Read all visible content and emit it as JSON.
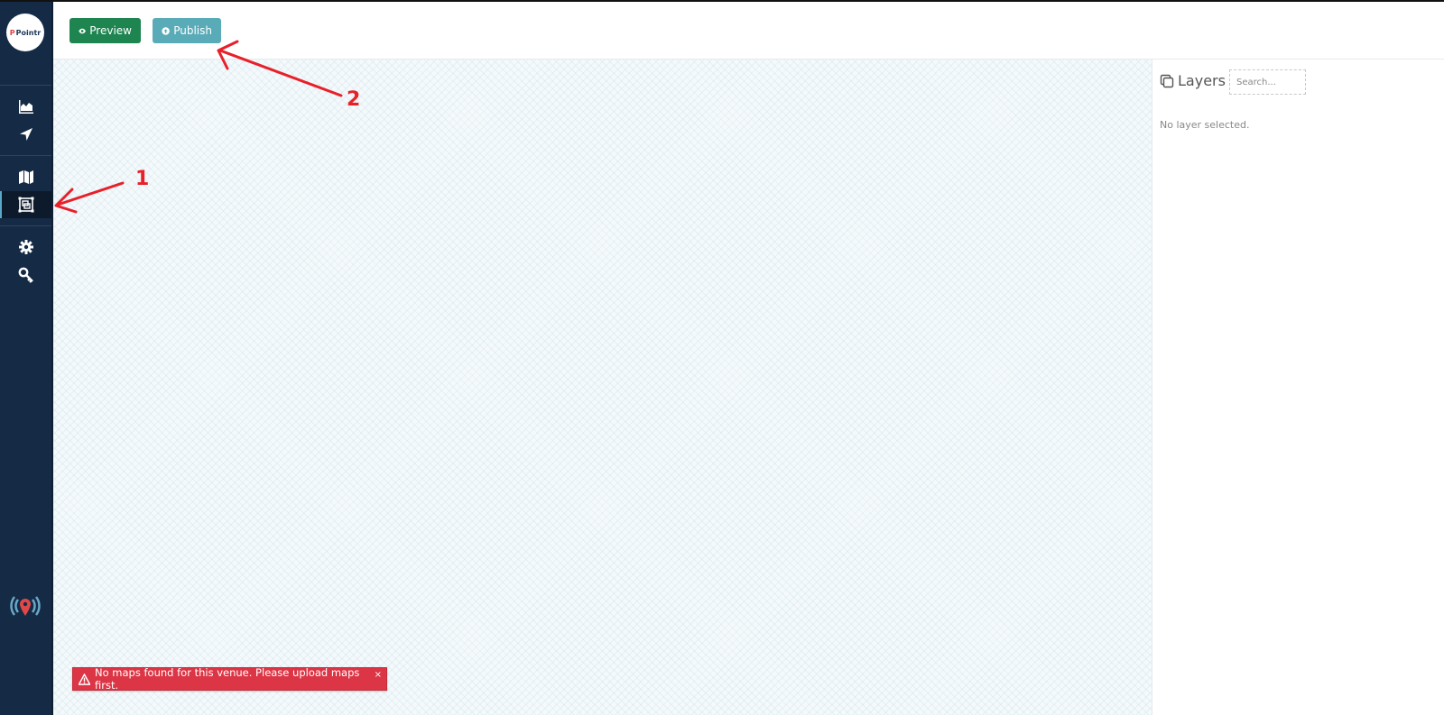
{
  "sidebar": {
    "logo_text": "Pointr",
    "logo_prefix": "P",
    "nav": [
      {
        "icon": "area-chart-icon",
        "label": "Analytics"
      },
      {
        "icon": "location-arrow-icon",
        "label": "Navigation"
      },
      {
        "icon": "map-icon",
        "label": "Maps"
      },
      {
        "icon": "map-editor-icon",
        "label": "Map Editor",
        "active": true
      },
      {
        "icon": "gear-icon",
        "label": "Settings"
      },
      {
        "icon": "key-icon",
        "label": "Keys"
      }
    ],
    "footer_icon": "beacon-pin-icon"
  },
  "toolbar": {
    "preview_label": "Preview",
    "publish_label": "Publish"
  },
  "layers_panel": {
    "title": "Layers",
    "search_placeholder": "Search...",
    "empty_message": "No layer selected."
  },
  "alert": {
    "message": "No maps found for this venue. Please upload maps first.",
    "close_label": "×",
    "color": "#dc3545"
  },
  "annotations": [
    {
      "number": "1",
      "target": "map-editor sidebar item"
    },
    {
      "number": "2",
      "target": "Publish button"
    }
  ],
  "colors": {
    "sidebar": "#152a45",
    "preview": "#1e8550",
    "publish": "#5aabb8",
    "annotation": "#e8202a"
  }
}
